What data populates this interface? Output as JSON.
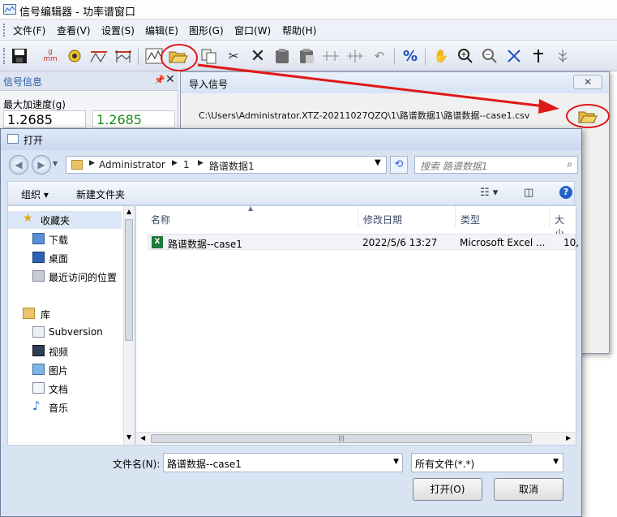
{
  "app": {
    "title": "信号编辑器 - 功率谱窗口"
  },
  "menu": [
    "文件(F)",
    "查看(V)",
    "设置(S)",
    "编辑(E)",
    "图形(G)",
    "窗口(W)",
    "帮助(H)"
  ],
  "toolbar": {
    "percent_label": "%",
    "gram_top": "g",
    "gram_bottom": "mm"
  },
  "left_panel": {
    "title": "信号信息",
    "accel_label": "最大加速度(g)",
    "value1": "1.2685",
    "value2": "1.2685",
    "value2_color": "#1a8f1a"
  },
  "import_dialog": {
    "title": "导入信号",
    "close": "✕",
    "path": "C:\\Users\\Administrator.XTZ-20211027QZQ\\1\\路谱数据1\\路谱数据--case1.csv"
  },
  "open_dialog": {
    "title": "打开",
    "breadcrumb": [
      "Administrator",
      "1",
      "路谱数据1"
    ],
    "search_placeholder": "搜索 路谱数据1",
    "organize": "组织 ▾",
    "new_folder": "新建文件夹",
    "nav": {
      "favorites": "收藏夹",
      "downloads": "下载",
      "desktop": "桌面",
      "recent": "最近访问的位置",
      "libraries": "库",
      "subversion": "Subversion",
      "videos": "视频",
      "pictures": "图片",
      "documents": "文档",
      "music": "音乐"
    },
    "columns": {
      "name": "名称",
      "date": "修改日期",
      "type": "类型",
      "size": "大小"
    },
    "file": {
      "name": "路谱数据--case1",
      "date": "2022/5/6 13:27",
      "type": "Microsoft Excel ...",
      "size": "10,"
    },
    "filename_label": "文件名(N):",
    "filename_value": "路谱数据--case1",
    "filetype_value": "所有文件(*.*)",
    "open_button": "打开(O)",
    "cancel_button": "取消"
  },
  "colors": {
    "accent": "#2457a8",
    "annotation": "#e01818"
  }
}
